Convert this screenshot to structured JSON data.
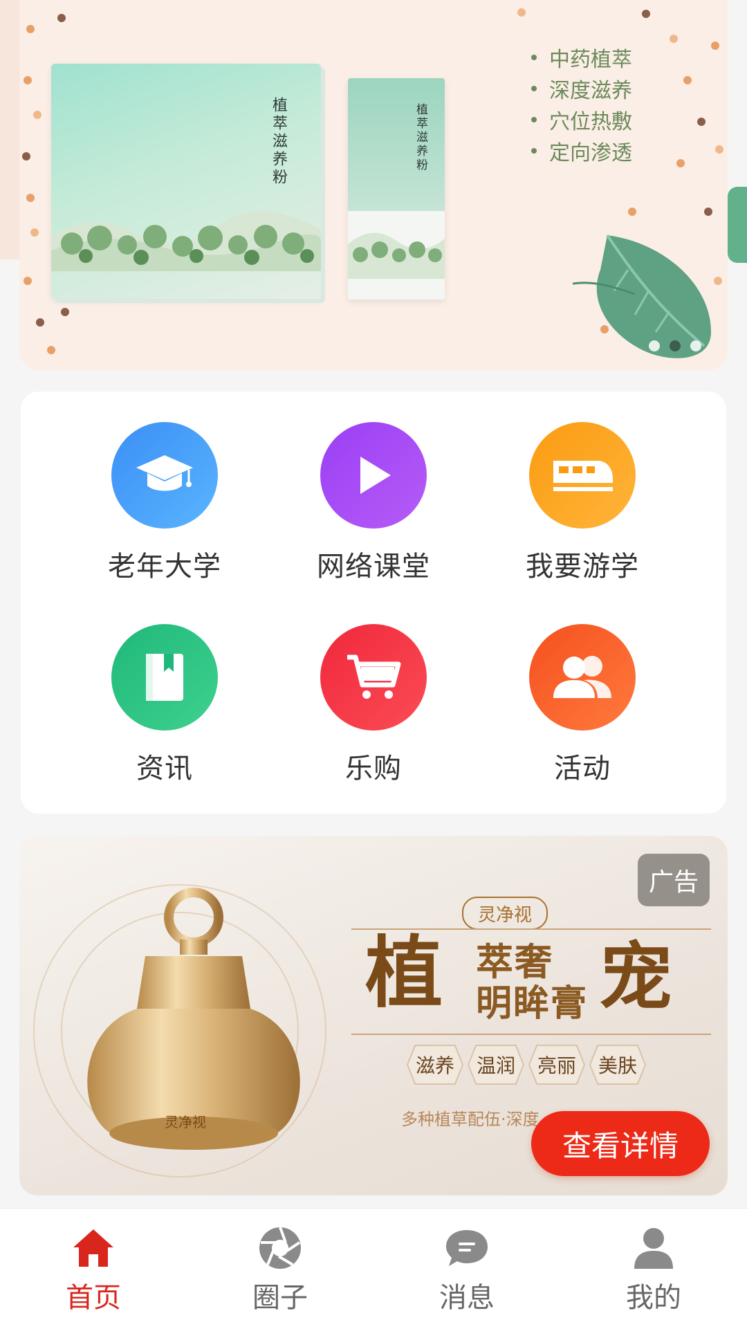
{
  "banner": {
    "box_title": "植萃滋养粉",
    "sachet_title": "植萃滋养粉",
    "features": [
      "中药植萃",
      "深度滋养",
      "穴位热敷",
      "定向渗透"
    ],
    "indicator_count": 3,
    "active_indicator": 2
  },
  "grid": {
    "items": [
      {
        "label": "老年大学",
        "icon": "graduation-cap-icon",
        "color_from": "#3b8ff5",
        "color_to": "#5ab4ff"
      },
      {
        "label": "网络课堂",
        "icon": "play-icon",
        "color_from": "#9a3ff5",
        "color_to": "#b65cf6"
      },
      {
        "label": "我要游学",
        "icon": "train-icon",
        "color_from": "#fb9b12",
        "color_to": "#ffb43a"
      },
      {
        "label": "资讯",
        "icon": "book-icon",
        "color_from": "#1fb87a",
        "color_to": "#3fd18f"
      },
      {
        "label": "乐购",
        "icon": "shopping-cart-icon",
        "color_from": "#f0283c",
        "color_to": "#fb4c55"
      },
      {
        "label": "活动",
        "icon": "users-icon",
        "color_from": "#f5501f",
        "color_to": "#ff7a3d"
      }
    ]
  },
  "ad": {
    "badge": "广告",
    "brand": "灵净视",
    "headline_1": "植",
    "headline_sub_1": "萃奢",
    "headline_sub_2": "明眸膏",
    "headline_2": "宠",
    "tags": [
      "滋养",
      "温润",
      "亮丽",
      "美肤"
    ],
    "slogan": "多种植草配伍·深度",
    "cta": "查看详情",
    "jar_label": "灵净视"
  },
  "tabbar": {
    "tabs": [
      {
        "label": "首页",
        "icon": "home-icon",
        "active": true
      },
      {
        "label": "圈子",
        "icon": "aperture-icon",
        "active": false
      },
      {
        "label": "消息",
        "icon": "chat-bubble-icon",
        "active": false
      },
      {
        "label": "我的",
        "icon": "user-icon",
        "active": false
      }
    ]
  },
  "colors": {
    "accent": "#d9261c",
    "cta": "#ec2a17",
    "banner_bg": "#fbeee6",
    "feature_text": "#6b8a5a"
  }
}
